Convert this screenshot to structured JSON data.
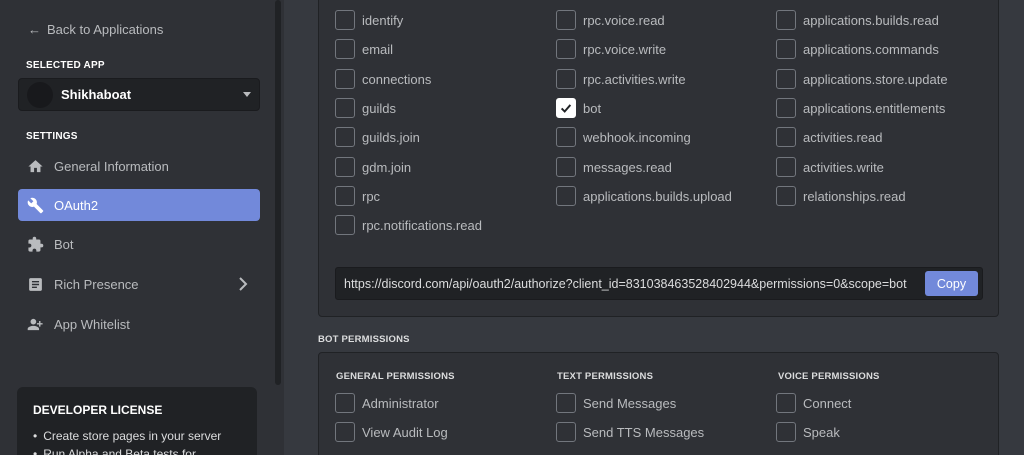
{
  "sidebar": {
    "back_label": "Back to Applications",
    "selected_app_label": "SELECTED APP",
    "selected_app_name": "Shikhaboat",
    "settings_label": "SETTINGS",
    "items": [
      {
        "label": "General Information",
        "icon": "home-icon"
      },
      {
        "label": "OAuth2",
        "icon": "wrench-icon",
        "active": true
      },
      {
        "label": "Bot",
        "icon": "puzzle-icon"
      },
      {
        "label": "Rich Presence",
        "icon": "document-icon",
        "has_submenu": true
      },
      {
        "label": "App Whitelist",
        "icon": "person-add-icon"
      }
    ],
    "license": {
      "title": "DEVELOPER LICENSE",
      "items": [
        "Create store pages in your server",
        "Run Alpha and Beta tests for..."
      ]
    }
  },
  "scopes": {
    "col1": [
      {
        "label": "identify",
        "checked": false
      },
      {
        "label": "email",
        "checked": false
      },
      {
        "label": "connections",
        "checked": false
      },
      {
        "label": "guilds",
        "checked": false
      },
      {
        "label": "guilds.join",
        "checked": false
      },
      {
        "label": "gdm.join",
        "checked": false
      },
      {
        "label": "rpc",
        "checked": false
      },
      {
        "label": "rpc.notifications.read",
        "checked": false
      }
    ],
    "col2": [
      {
        "label": "rpc.voice.read",
        "checked": false
      },
      {
        "label": "rpc.voice.write",
        "checked": false
      },
      {
        "label": "rpc.activities.write",
        "checked": false
      },
      {
        "label": "bot",
        "checked": true
      },
      {
        "label": "webhook.incoming",
        "checked": false
      },
      {
        "label": "messages.read",
        "checked": false
      },
      {
        "label": "applications.builds.upload",
        "checked": false
      }
    ],
    "col3": [
      {
        "label": "applications.builds.read",
        "checked": false
      },
      {
        "label": "applications.commands",
        "checked": false
      },
      {
        "label": "applications.store.update",
        "checked": false
      },
      {
        "label": "applications.entitlements",
        "checked": false
      },
      {
        "label": "activities.read",
        "checked": false
      },
      {
        "label": "activities.write",
        "checked": false
      },
      {
        "label": "relationships.read",
        "checked": false
      }
    ],
    "url": "https://discord.com/api/oauth2/authorize?client_id=831038463528402944&permissions=0&scope=bot",
    "copy_label": "Copy"
  },
  "bot_permissions": {
    "label": "BOT PERMISSIONS",
    "general": {
      "title": "GENERAL PERMISSIONS",
      "items": [
        "Administrator",
        "View Audit Log"
      ]
    },
    "text": {
      "title": "TEXT PERMISSIONS",
      "items": [
        "Send Messages",
        "Send TTS Messages"
      ]
    },
    "voice": {
      "title": "VOICE PERMISSIONS",
      "items": [
        "Connect",
        "Speak"
      ]
    }
  },
  "colors": {
    "accent": "#7289da",
    "sidebar_bg": "#2f3136",
    "main_bg": "#36393f"
  }
}
